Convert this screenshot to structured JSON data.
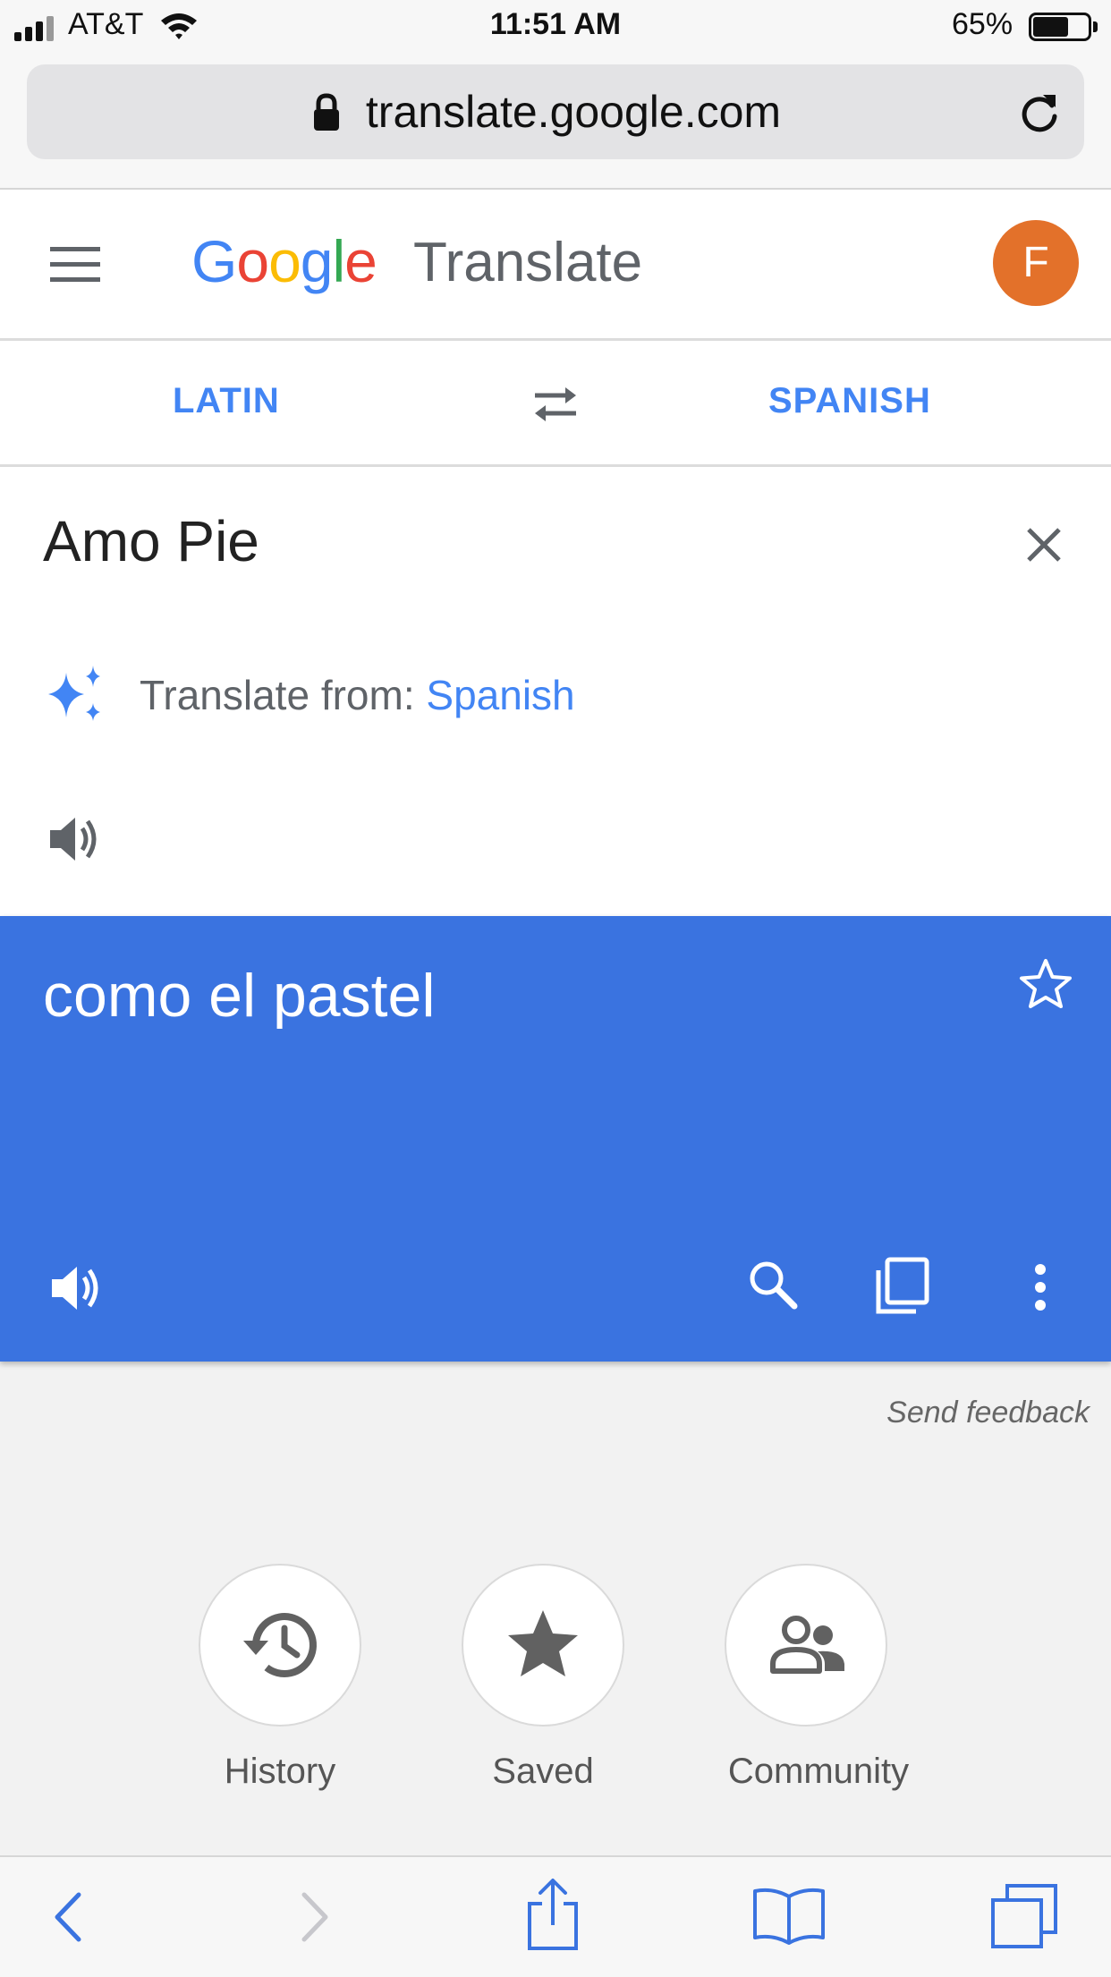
{
  "status": {
    "carrier": "AT&T",
    "time": "11:51 AM",
    "battery": "65%",
    "battery_level": 0.65
  },
  "browser": {
    "url": "translate.google.com"
  },
  "header": {
    "logo_word": "Google",
    "product": "Translate",
    "avatar_letter": "F",
    "avatar_color": "#e3712a"
  },
  "languages": {
    "source": "LATIN",
    "target": "SPANISH"
  },
  "input": {
    "text": "Amo Pie",
    "suggestion_prefix": "Translate from: ",
    "suggestion_lang": "Spanish"
  },
  "result": {
    "text": "como el pastel",
    "color": "#3a73e0"
  },
  "feedback": "Send feedback",
  "bottom": {
    "history": "History",
    "saved": "Saved",
    "community": "Community"
  },
  "colors": {
    "accent": "#4285f4",
    "icon_gray": "#616161"
  }
}
